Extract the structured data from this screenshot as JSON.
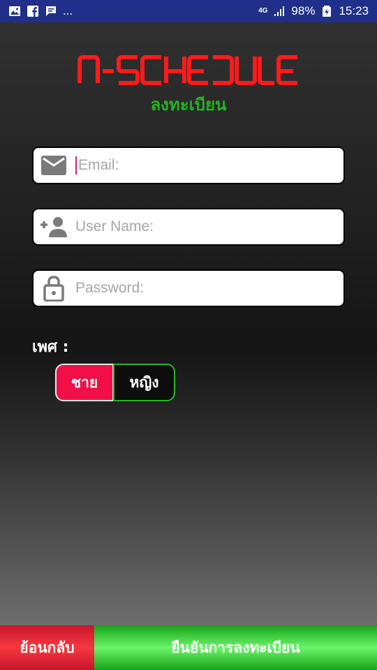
{
  "status_bar": {
    "left_icons": [
      "image-icon",
      "facebook-icon",
      "message-icon"
    ],
    "overflow": "...",
    "network": "4G",
    "battery": "98%",
    "time": "15:23"
  },
  "logo": {
    "text": "N-SCHEDULE",
    "color": "#ff1b1b"
  },
  "subtitle": "ลงทะเบียน",
  "fields": {
    "email": {
      "placeholder": "Email:",
      "icon": "mail-icon"
    },
    "username": {
      "placeholder": "User Name:",
      "icon": "add-person-icon"
    },
    "password": {
      "placeholder": "Password:",
      "icon": "lock-icon"
    }
  },
  "gender": {
    "label": "เพศ :",
    "options": [
      "ชาย",
      "หญิง"
    ],
    "selected": "ชาย"
  },
  "buttons": {
    "back": "ย้อนกลับ",
    "register": "ยืนยันการลงทะเบียน"
  },
  "colors": {
    "accent_red": "#f20f48",
    "accent_green": "#22b51f",
    "status_bar": "#1f2f8a"
  }
}
